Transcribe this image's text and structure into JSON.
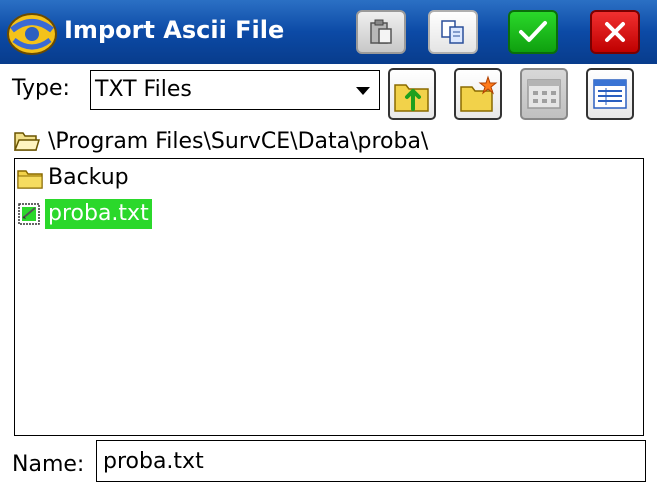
{
  "window": {
    "title": "Import Ascii File",
    "icon": "app-logo-icon",
    "buttons": {
      "paste": "paste-icon",
      "copy": "copy-icon",
      "ok": "check-icon",
      "close": "close-icon"
    }
  },
  "type": {
    "label": "Type:",
    "selected": "TXT Files"
  },
  "toolbar": {
    "icons": [
      "folder-up-icon",
      "new-folder-icon",
      "icon-view-icon",
      "detail-view-icon"
    ]
  },
  "path": "\\Program Files\\SurvCE\\Data\\proba\\",
  "files": [
    {
      "name": "Backup",
      "kind": "folder",
      "selected": false
    },
    {
      "name": "proba.txt",
      "kind": "file",
      "selected": true
    }
  ],
  "name_field": {
    "label": "Name:",
    "value": "proba.txt"
  },
  "colors": {
    "titlebar": "#0c4aa6",
    "selection": "#2bd82b",
    "ok_button": "#1ec01e",
    "close_button": "#e01818"
  }
}
